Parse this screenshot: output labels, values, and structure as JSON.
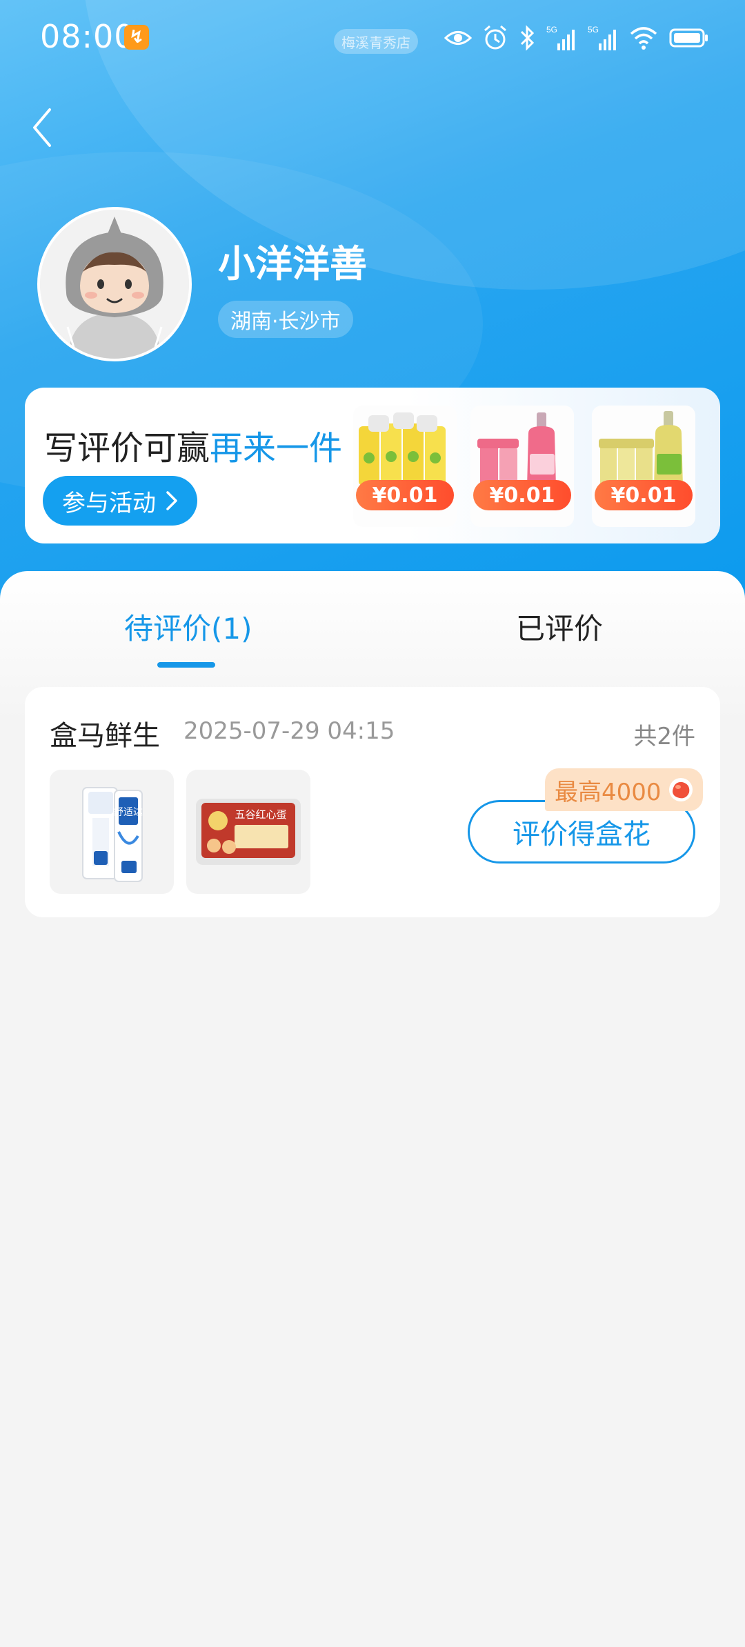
{
  "status_bar": {
    "time": "08:00",
    "app_badge": "↯",
    "pill_text": "梅溪青秀店",
    "network_1": "5G",
    "network_2": "5G"
  },
  "header": {
    "back_icon": "chevron-left-icon",
    "username": "小洋洋善",
    "location": "湖南·长沙市"
  },
  "promo": {
    "title_plain": "写评价可赢",
    "title_highlight": "再来一件",
    "cta_label": "参与活动",
    "products": [
      {
        "price": "¥0.01",
        "theme": "#f4d63a"
      },
      {
        "price": "¥0.01",
        "theme": "#f06b8a"
      },
      {
        "price": "¥0.01",
        "theme": "#e9e08a"
      }
    ]
  },
  "tabs": {
    "pending_label": "待评价(1)",
    "done_label": "已评价"
  },
  "order": {
    "store_name": "盒马鲜生",
    "time": "2025-07-29 04:15",
    "count": "共2件",
    "reward": "最高4000",
    "review_button": "评价得盒花",
    "products": [
      {
        "name": "SENSODYNE 舒适达",
        "brand_text": "舒适达"
      },
      {
        "name": "五谷红心蛋",
        "brand_text": "五谷红心蛋"
      }
    ]
  },
  "colors": {
    "accent": "#1697e8",
    "header_blue": "#2aa6f0",
    "price_red": "#ff4d2d",
    "reward_bg": "#fde1c6"
  }
}
